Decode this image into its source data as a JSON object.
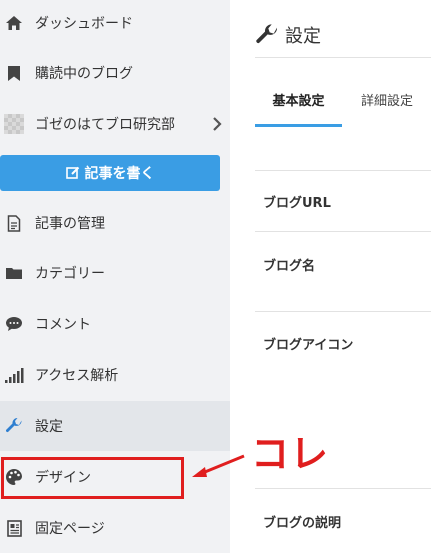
{
  "sidebar": {
    "items": [
      {
        "label": "ダッシュボード"
      },
      {
        "label": "購読中のブログ"
      },
      {
        "label": "ゴゼのはてブロ研究部"
      },
      {
        "label": "記事の管理"
      },
      {
        "label": "カテゴリー"
      },
      {
        "label": "コメント"
      },
      {
        "label": "アクセス解析"
      },
      {
        "label": "設定"
      },
      {
        "label": "デザイン"
      },
      {
        "label": "固定ページ"
      }
    ],
    "write_button_label": "記事を書く"
  },
  "main": {
    "title": "設定",
    "tabs": [
      {
        "label": "基本設定"
      },
      {
        "label": "詳細設定"
      }
    ],
    "fields": [
      {
        "label": "ブログURL"
      },
      {
        "label": "ブログ名"
      },
      {
        "label": "ブログアイコン"
      },
      {
        "label": "ブログの説明"
      }
    ]
  },
  "annotation": {
    "text": "コレ",
    "color": "#e01e1e"
  },
  "colors": {
    "accent": "#3a9de4",
    "sidebar_bg": "#f1f2f4",
    "active_bg": "#e3e6ea"
  }
}
